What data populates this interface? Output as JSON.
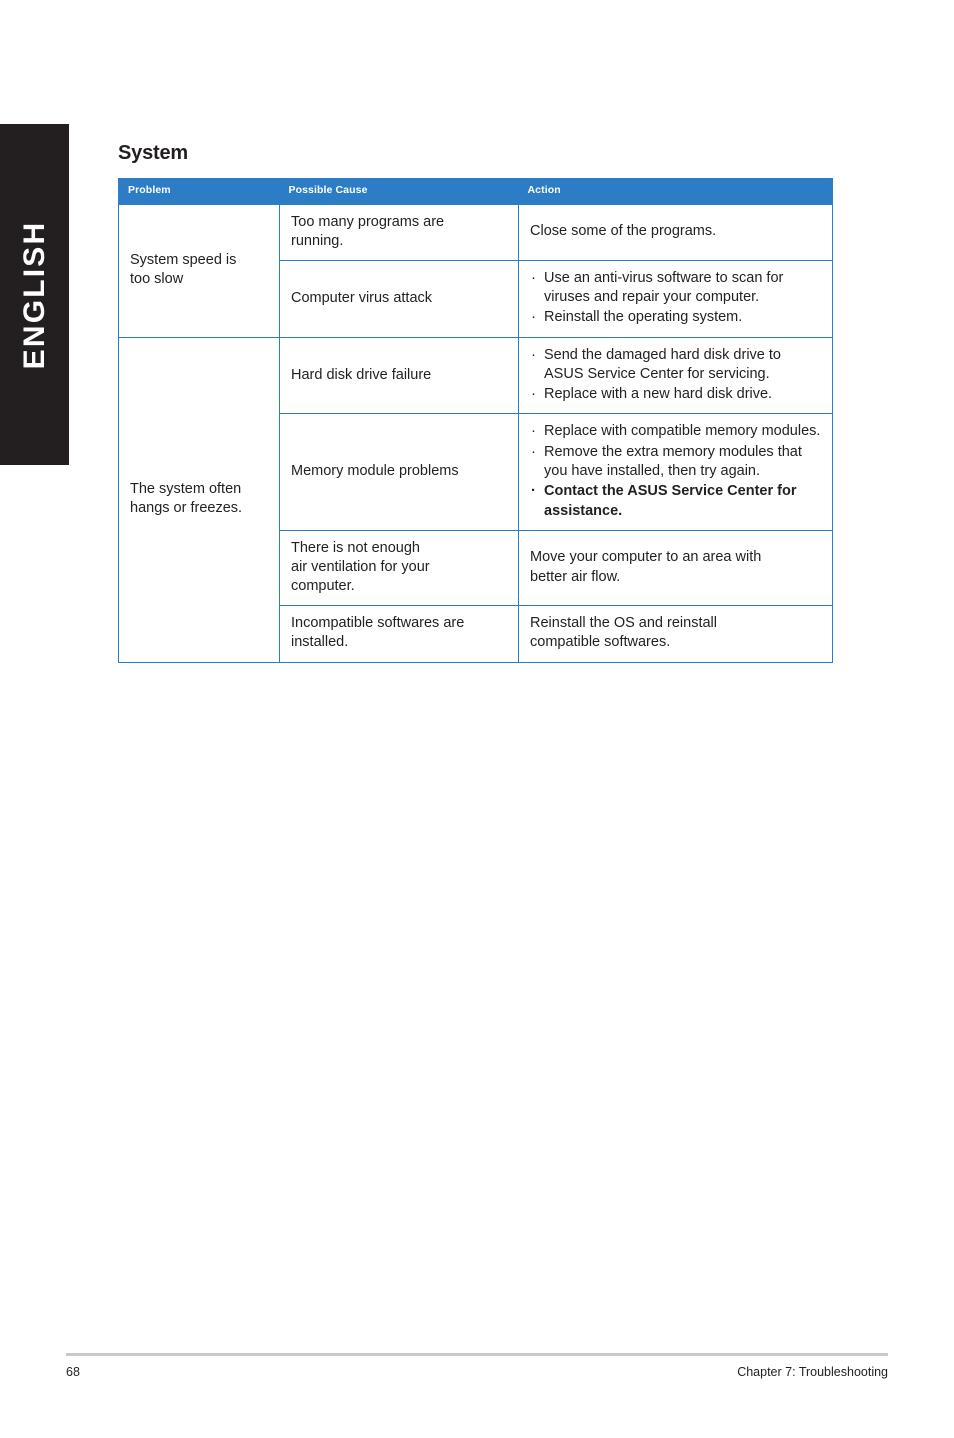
{
  "language_tab": {
    "label": "ENGLISH"
  },
  "section": {
    "title": "System"
  },
  "table": {
    "headers": {
      "problem": "Problem",
      "cause": "Possible Cause",
      "action": "Action"
    },
    "groups": [
      {
        "problem": "System speed is\ntoo slow",
        "problem_lines": [
          "System speed is",
          "too slow"
        ],
        "rows": [
          {
            "cause_lines": [
              "Too many programs are",
              "running."
            ],
            "action_type": "plain",
            "action_lines": [
              "Close some of the programs."
            ]
          },
          {
            "cause_lines": [
              "Computer virus attack"
            ],
            "action_type": "bullets",
            "action_bullets": [
              "Use an anti-virus software to scan for viruses and repair your computer.",
              "Reinstall the operating system."
            ]
          }
        ]
      },
      {
        "problem": "The system often\nhangs or freezes.",
        "problem_lines": [
          "The system often",
          "hangs or freezes."
        ],
        "rows": [
          {
            "cause_lines": [
              "Hard disk drive failure"
            ],
            "action_type": "bullets",
            "action_bullets": [
              "Send the damaged hard disk drive to ASUS Service Center for servicing.",
              "Replace with a new hard disk drive."
            ]
          },
          {
            "cause_lines": [
              "Memory module problems"
            ],
            "action_type": "bullets",
            "action_bullets": [
              "Replace with compatible memory modules.",
              "Remove the extra memory modules that you have installed, then try again.",
              "Contact the ASUS Service Center for assistance."
            ]
          },
          {
            "cause_lines": [
              "There is not enough",
              "air ventilation for your",
              "computer."
            ],
            "action_type": "plain",
            "action_lines": [
              "Move your computer to an area with",
              "better air flow."
            ]
          },
          {
            "cause_lines": [
              "Incompatible softwares are",
              "installed."
            ],
            "action_type": "plain",
            "action_lines": [
              "Reinstall the OS and reinstall",
              "compatible softwares."
            ]
          }
        ]
      }
    ]
  },
  "footer": {
    "page_number": "68",
    "chapter": "Chapter 7: Troubleshooting"
  },
  "colors": {
    "header_blue": "#2d7cc6",
    "border_blue": "#2d7cc6",
    "tab_black": "#231f20",
    "text": "#231f20",
    "footer_rule": "#c9c9c9"
  }
}
